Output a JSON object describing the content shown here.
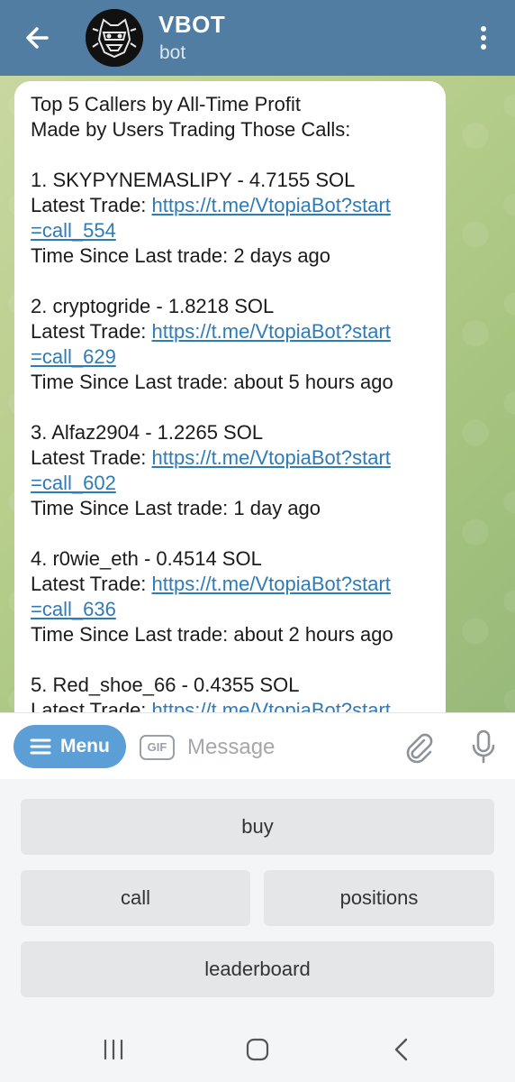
{
  "header": {
    "title": "VBOT",
    "subtitle": "bot"
  },
  "message": {
    "heading": [
      "Top 5 Callers by All-Time Profit",
      "Made by Users Trading Those Calls:"
    ],
    "entries": [
      {
        "rank_line": "1. SKYPYNEMASLIPY - 4.7155 SOL",
        "trade_prefix": "Latest Trade: ",
        "link_part1": "https://t.me/VtopiaBot?start",
        "link_part2": "=call_554",
        "time_line": "Time Since Last trade: 2 days ago"
      },
      {
        "rank_line": "2. cryptogride - 1.8218 SOL",
        "trade_prefix": "Latest Trade: ",
        "link_part1": "https://t.me/VtopiaBot?start",
        "link_part2": "=call_629",
        "time_line": "Time Since Last trade: about 5 hours ago"
      },
      {
        "rank_line": "3. Alfaz2904 - 1.2265 SOL",
        "trade_prefix": "Latest Trade: ",
        "link_part1": "https://t.me/VtopiaBot?start",
        "link_part2": "=call_602",
        "time_line": "Time Since Last trade: 1 day ago"
      },
      {
        "rank_line": "4. r0wie_eth - 0.4514 SOL",
        "trade_prefix": "Latest Trade: ",
        "link_part1": "https://t.me/VtopiaBot?start",
        "link_part2": "=call_636",
        "time_line": "Time Since Last trade: about 2 hours ago"
      },
      {
        "rank_line": "5. Red_shoe_66 - 0.4355 SOL",
        "trade_prefix": "Latest Trade: ",
        "link_part1": "https://t.me/VtopiaBot?start",
        "link_part2": "",
        "time_line": ""
      }
    ]
  },
  "input": {
    "menu_label": "Menu",
    "gif_label": "GIF",
    "placeholder": "Message"
  },
  "keyboard": {
    "buy": "buy",
    "call": "call",
    "positions": "positions",
    "leaderboard": "leaderboard"
  },
  "colors": {
    "header": "#517da2",
    "menu_button": "#5b9fd6",
    "link": "#2f7bb8"
  },
  "icons": [
    "back-arrow-icon",
    "bot-avatar",
    "more-vert-icon",
    "menu-icon",
    "gif-icon",
    "attach-icon",
    "mic-icon",
    "recent-apps-icon",
    "home-icon",
    "back-nav-icon"
  ]
}
